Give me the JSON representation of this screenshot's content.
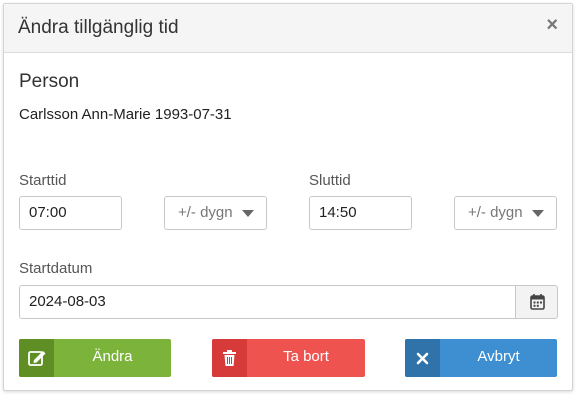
{
  "dialog": {
    "title": "Ändra tillgänglig tid",
    "close_symbol": "×"
  },
  "person": {
    "section_label": "Person",
    "name": "Carlsson Ann-Marie 1993-07-31"
  },
  "start_time": {
    "label": "Starttid",
    "value": "07:00",
    "day_offset": "+/- dygn"
  },
  "end_time": {
    "label": "Sluttid",
    "value": "14:50",
    "day_offset": "+/- dygn"
  },
  "start_date": {
    "label": "Startdatum",
    "value": "2024-08-03",
    "icon": "calendar-icon"
  },
  "buttons": {
    "edit_label": "Ändra",
    "edit_icon": "edit-icon",
    "delete_label": "Ta bort",
    "delete_icon": "trash-icon",
    "cancel_label": "Avbryt",
    "cancel_icon": "close-icon"
  },
  "colors": {
    "edit": "#7cb33b",
    "delete": "#ef5350",
    "cancel": "#3d8fd1"
  }
}
